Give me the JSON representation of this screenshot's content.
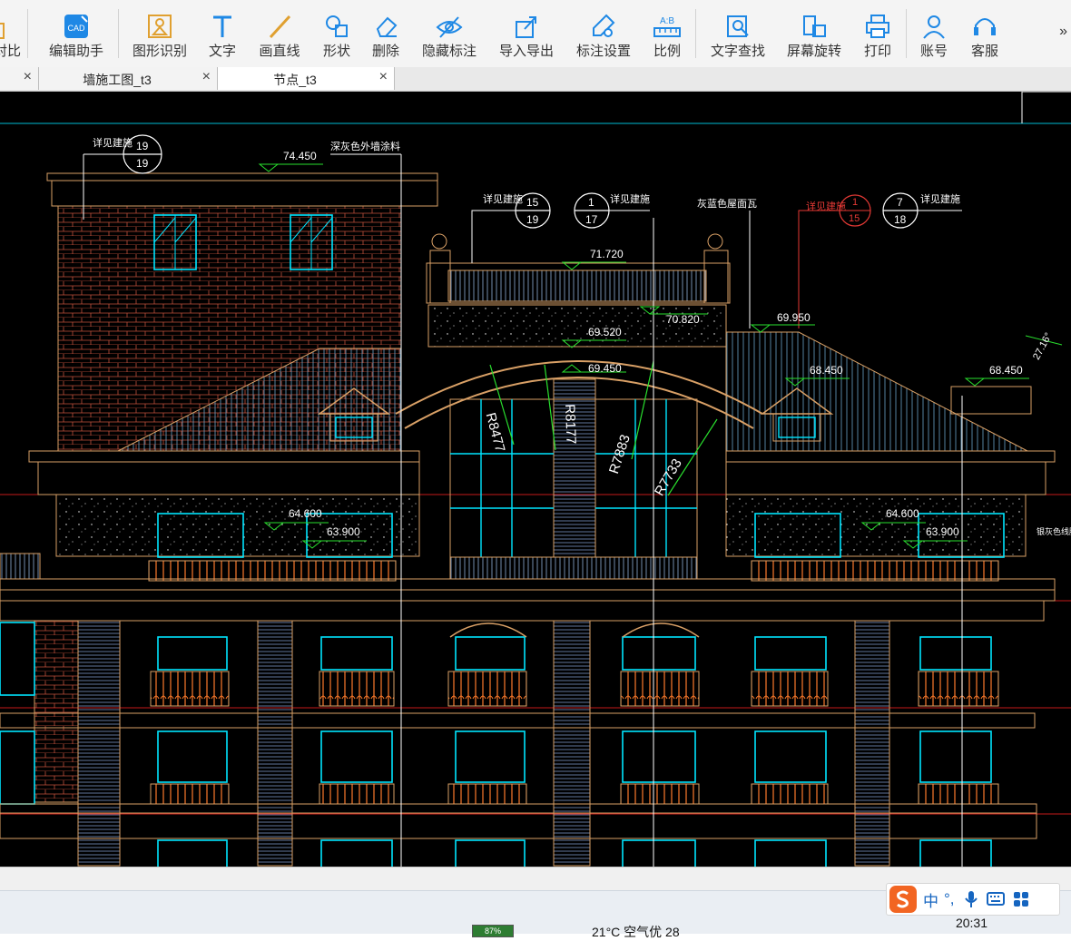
{
  "toolbar": {
    "items": [
      {
        "label": "对比",
        "icon": "compare-icon"
      },
      {
        "label": "编辑助手",
        "icon": "cad-edit-icon"
      },
      {
        "label": "图形识别",
        "icon": "shape-recognize-icon"
      },
      {
        "label": "文字",
        "icon": "text-icon"
      },
      {
        "label": "画直线",
        "icon": "line-icon"
      },
      {
        "label": "形状",
        "icon": "shape-icon"
      },
      {
        "label": "删除",
        "icon": "eraser-icon"
      },
      {
        "label": "隐藏标注",
        "icon": "eye-hidden-icon"
      },
      {
        "label": "导入导出",
        "icon": "import-export-icon"
      },
      {
        "label": "标注设置",
        "icon": "annotation-settings-icon"
      },
      {
        "label": "比例",
        "icon": "scale-icon"
      },
      {
        "label": "文字查找",
        "icon": "text-search-icon"
      },
      {
        "label": "屏幕旋转",
        "icon": "rotate-screen-icon"
      },
      {
        "label": "打印",
        "icon": "printer-icon"
      },
      {
        "label": "账号",
        "icon": "account-icon"
      },
      {
        "label": "客服",
        "icon": "headset-icon"
      }
    ],
    "more": "»",
    "cad_badge": "CAD"
  },
  "tabs": [
    {
      "label": "",
      "close": "×"
    },
    {
      "label": "墙施工图_t3",
      "close": "×"
    },
    {
      "label": "节点_t3",
      "close": "×"
    }
  ],
  "drawing": {
    "callouts": [
      "详见建施",
      "详见建施",
      "详见建施",
      "详见建施",
      "详见建施"
    ],
    "detail_refs": [
      {
        "top": "19",
        "bottom": "19"
      },
      {
        "top": "15",
        "bottom": "19"
      },
      {
        "top": "1",
        "bottom": "17"
      },
      {
        "top": "1",
        "bottom": "15"
      },
      {
        "top": "7",
        "bottom": "18"
      }
    ],
    "notes": {
      "wall_paint": "深灰色外墙涂料",
      "roof_tile": "灰蓝色屋面瓦",
      "right_edge": "银灰色线脚"
    },
    "elevations": [
      "74.450",
      "71.720",
      "70.820",
      "69.950",
      "69.520",
      "69.450",
      "68.450",
      "68.450",
      "64.600",
      "63.900",
      "64.600",
      "63.900"
    ],
    "radii": [
      "R8477",
      "R8177",
      "R7883",
      "R7733"
    ],
    "angle": "27.16°"
  },
  "taskbar": {
    "battery": "87%",
    "weather": "21°C  空气优 28",
    "time": "20:31",
    "ime": {
      "lang": "中",
      "punct": "°,"
    }
  },
  "colors": {
    "canvas_bg": "#000000",
    "building_lines": "#d9a066",
    "window_cyan": "#00e5ff",
    "dim_green": "#29e02e",
    "grid_red": "#c41a1a",
    "annotation_white": "#ffffff"
  }
}
